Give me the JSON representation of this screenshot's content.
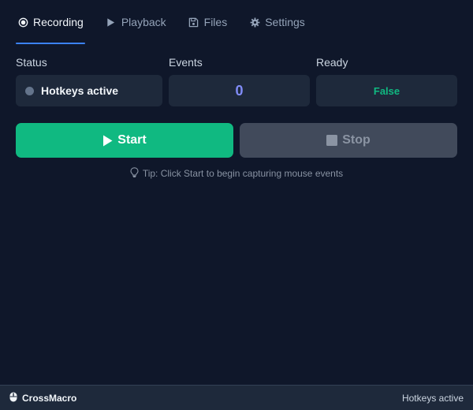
{
  "tabs": [
    {
      "label": "Recording",
      "icon": "radio-record-icon",
      "active": true
    },
    {
      "label": "Playback",
      "icon": "play-icon",
      "active": false
    },
    {
      "label": "Files",
      "icon": "save-icon",
      "active": false
    },
    {
      "label": "Settings",
      "icon": "gear-icon",
      "active": false
    }
  ],
  "stats": {
    "status": {
      "label": "Status",
      "value": "Hotkeys active"
    },
    "events": {
      "label": "Events",
      "value": "0"
    },
    "ready": {
      "label": "Ready",
      "value": "False"
    }
  },
  "actions": {
    "start_label": "Start",
    "stop_label": "Stop"
  },
  "tip": "Tip: Click Start to begin capturing mouse events",
  "footer": {
    "app_name": "CrossMacro",
    "status": "Hotkeys active"
  },
  "colors": {
    "background": "#0f172a",
    "card": "#1e293b",
    "accent_tab": "#3b82f6",
    "start": "#10b981",
    "stop": "#414a5b",
    "events_value": "#818cf8",
    "ready_value": "#10b981"
  }
}
